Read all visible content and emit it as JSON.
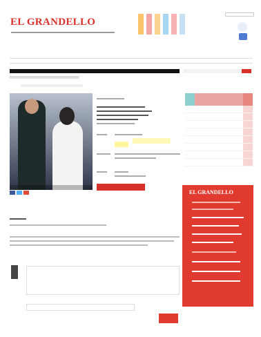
{
  "brand": {
    "logo": "EL GRANDELLO",
    "tagline": ""
  },
  "promo": {
    "colors": [
      "#f9c46c",
      "#f6a8a4",
      "#fbd58f",
      "#a8d5f2",
      "#f7b3b3",
      "#c6e0f7"
    ],
    "label": ""
  },
  "header": {
    "search_placeholder": "",
    "weather_value": ""
  },
  "nav": {
    "items": [
      "",
      "",
      "",
      "",
      "",
      "",
      "",
      "",
      "",
      "",
      "",
      ""
    ]
  },
  "article": {
    "section_bar": "",
    "crumb": "",
    "subcrumb": "",
    "detail_title": "",
    "buy_label": "",
    "section_title": "",
    "comment_title": "",
    "comment_placeholder": "",
    "name_label": "",
    "submit_label": ""
  },
  "sidebar": {
    "calendar_days": [
      "",
      "",
      "",
      "",
      "",
      "",
      ""
    ],
    "promo_title": "EL GRANDELLO"
  },
  "colors": {
    "brand": "#d9302a",
    "highlight": "#fff59a"
  }
}
